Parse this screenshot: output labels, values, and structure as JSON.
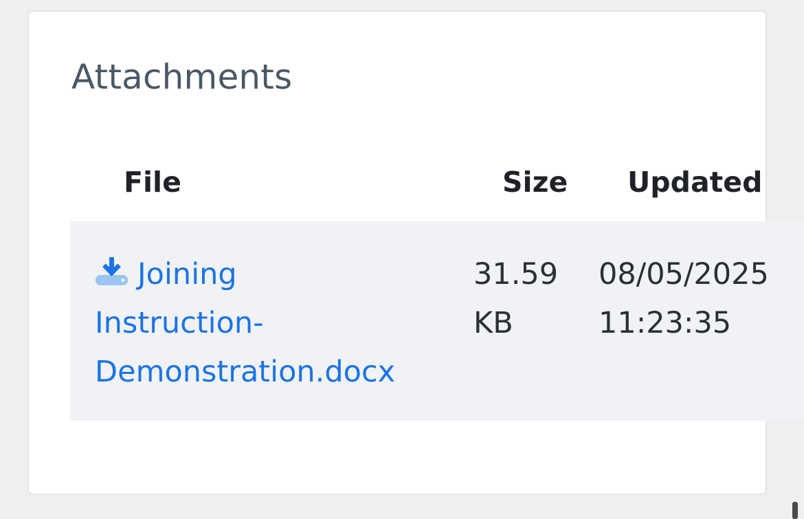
{
  "attachments": {
    "title": "Attachments",
    "columns": {
      "file": "File",
      "size": "Size",
      "updated": "Updated"
    },
    "rows": [
      {
        "file_line1": "Joining",
        "file_line2": "Instruction-",
        "file_line3": "Demonstration.docx",
        "size_line1": "31.59",
        "size_line2": "KB",
        "updated_line1": "08/05/2025",
        "updated_line2": "11:23:35",
        "icon": "download-icon"
      }
    ]
  },
  "colors": {
    "link": "#1a73e8",
    "row_background": "#f1f2f5",
    "title": "#4a5866"
  }
}
